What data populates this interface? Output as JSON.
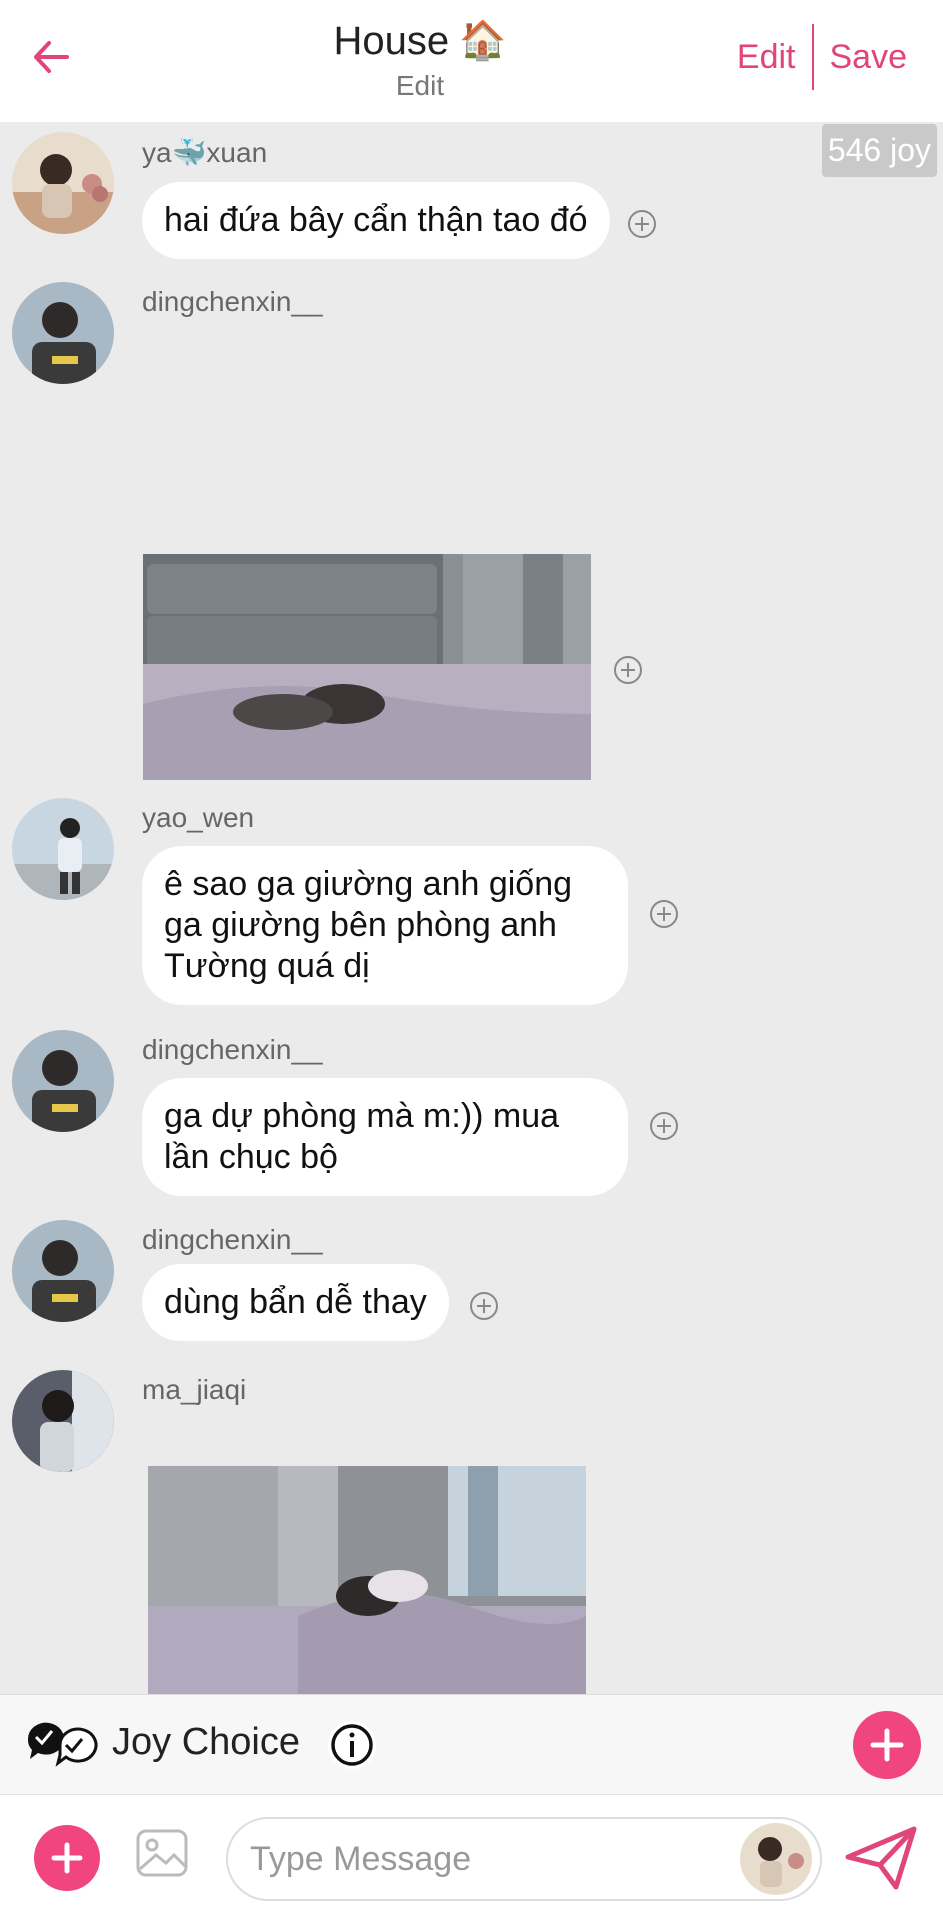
{
  "header": {
    "back_icon": "arrow-left-icon",
    "title": "House",
    "title_emoji": "🏠",
    "subtitle": "Edit",
    "edit_label": "Edit",
    "save_label": "Save",
    "accent_color": "#e0457b"
  },
  "joy_badge": "546 joy",
  "messages": [
    {
      "username": "ya🐳xuan",
      "text": "hai đứa bây cẩn thận tao đó",
      "type": "text"
    },
    {
      "username": "dingchenxin__",
      "type": "image"
    },
    {
      "username": "yao_wen",
      "text": "ê sao ga giường anh giống ga giường bên phòng anh Tường quá dị",
      "type": "text"
    },
    {
      "username": "dingchenxin__",
      "text": "ga dự phòng mà m:)) mua lần chục bộ",
      "type": "text"
    },
    {
      "username": "dingchenxin__",
      "text": "dùng bẩn dễ thay",
      "type": "text"
    },
    {
      "username": "ma_jiaqi",
      "type": "image"
    }
  ],
  "joybar": {
    "label": "Joy Choice",
    "icons": [
      "joy-choice-icon",
      "info-icon",
      "plus-icon"
    ]
  },
  "input": {
    "placeholder": "Type Message",
    "icons": [
      "plus-icon",
      "gallery-icon",
      "send-icon"
    ]
  }
}
